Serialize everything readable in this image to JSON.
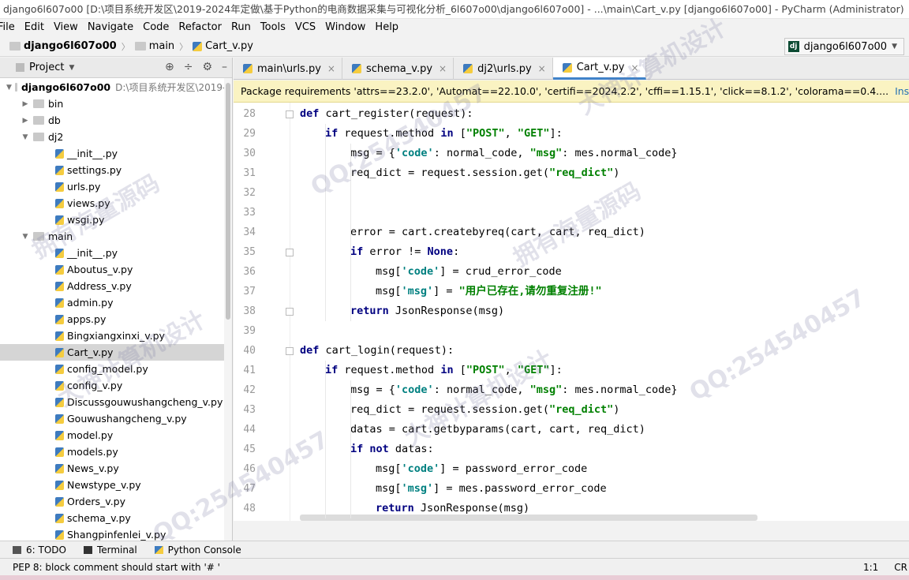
{
  "window": {
    "title": "django6l607o00 [D:\\项目系统开发区\\2019-2024年定做\\基于Python的电商数据采集与可视化分析_6l607o00\\django6l607o00] - ...\\main\\Cart_v.py [django6l607o00] - PyCharm (Administrator)"
  },
  "menu": [
    "File",
    "Edit",
    "View",
    "Navigate",
    "Code",
    "Refactor",
    "Run",
    "Tools",
    "VCS",
    "Window",
    "Help"
  ],
  "breadcrumb": {
    "project": "django6l607o00",
    "folder": "main",
    "file": "Cart_v.py"
  },
  "run_config": {
    "label": "django6l607o00",
    "icon": "dj"
  },
  "project_panel": {
    "title": "Project",
    "root": {
      "name": "django6l607o00",
      "path": "D:\\项目系统开发区\\2019-2"
    },
    "items": [
      {
        "label": "bin",
        "type": "folder",
        "level": 1,
        "state": "collapsed"
      },
      {
        "label": "db",
        "type": "folder",
        "level": 1,
        "state": "collapsed"
      },
      {
        "label": "dj2",
        "type": "folder",
        "level": 1,
        "state": "expanded"
      },
      {
        "label": "__init__.py",
        "type": "py",
        "level": 2
      },
      {
        "label": "settings.py",
        "type": "py",
        "level": 2
      },
      {
        "label": "urls.py",
        "type": "py",
        "level": 2
      },
      {
        "label": "views.py",
        "type": "py",
        "level": 2
      },
      {
        "label": "wsgi.py",
        "type": "py",
        "level": 2
      },
      {
        "label": "main",
        "type": "folder",
        "level": 1,
        "state": "expanded"
      },
      {
        "label": "__init__.py",
        "type": "py",
        "level": 2
      },
      {
        "label": "Aboutus_v.py",
        "type": "py",
        "level": 2
      },
      {
        "label": "Address_v.py",
        "type": "py",
        "level": 2
      },
      {
        "label": "admin.py",
        "type": "py",
        "level": 2
      },
      {
        "label": "apps.py",
        "type": "py",
        "level": 2
      },
      {
        "label": "Bingxiangxinxi_v.py",
        "type": "py",
        "level": 2
      },
      {
        "label": "Cart_v.py",
        "type": "py",
        "level": 2,
        "selected": true
      },
      {
        "label": "config_model.py",
        "type": "py",
        "level": 2
      },
      {
        "label": "config_v.py",
        "type": "py",
        "level": 2
      },
      {
        "label": "Discussgouwushangcheng_v.py",
        "type": "py",
        "level": 2
      },
      {
        "label": "Gouwushangcheng_v.py",
        "type": "py",
        "level": 2
      },
      {
        "label": "model.py",
        "type": "py",
        "level": 2
      },
      {
        "label": "models.py",
        "type": "py",
        "level": 2
      },
      {
        "label": "News_v.py",
        "type": "py",
        "level": 2
      },
      {
        "label": "Newstype_v.py",
        "type": "py",
        "level": 2
      },
      {
        "label": "Orders_v.py",
        "type": "py",
        "level": 2
      },
      {
        "label": "schema_v.py",
        "type": "py",
        "level": 2
      },
      {
        "label": "Shangpinfenlei_v.py",
        "type": "py",
        "level": 2
      }
    ]
  },
  "tabs": [
    {
      "label": "main\\urls.py",
      "active": false
    },
    {
      "label": "schema_v.py",
      "active": false
    },
    {
      "label": "dj2\\urls.py",
      "active": false
    },
    {
      "label": "Cart_v.py",
      "active": true
    }
  ],
  "banner": {
    "text": "Package requirements 'attrs==23.2.0', 'Automat==22.10.0', 'certifi==2024.2.2', 'cffi==1.15.1', 'click==8.1.2', 'colorama==0.4....",
    "action": "Install requirements"
  },
  "code_lines": [
    {
      "n": "28",
      "indent": 0,
      "tokens": [
        [
          "kw",
          "def"
        ],
        [
          "t",
          " cart_register(request):"
        ]
      ]
    },
    {
      "n": "29",
      "indent": 1,
      "tokens": [
        [
          "kw",
          "if"
        ],
        [
          "t",
          " request.method "
        ],
        [
          "kw",
          "in"
        ],
        [
          "t",
          " ["
        ],
        [
          "str",
          "\"POST\""
        ],
        [
          "t",
          ", "
        ],
        [
          "str",
          "\"GET\""
        ],
        [
          "t",
          "]:"
        ]
      ]
    },
    {
      "n": "30",
      "indent": 2,
      "tokens": [
        [
          "t",
          "msg = {"
        ],
        [
          "hs",
          "'code'"
        ],
        [
          "t",
          ": normal_code, "
        ],
        [
          "str",
          "\"msg\""
        ],
        [
          "t",
          ": mes.normal_code}"
        ]
      ]
    },
    {
      "n": "31",
      "indent": 2,
      "tokens": [
        [
          "t",
          "req_dict = request.session.get("
        ],
        [
          "str",
          "\"req_dict\""
        ],
        [
          "t",
          ")"
        ]
      ]
    },
    {
      "n": "32",
      "indent": 0,
      "tokens": []
    },
    {
      "n": "33",
      "indent": 0,
      "tokens": []
    },
    {
      "n": "34",
      "indent": 2,
      "tokens": [
        [
          "t",
          "error = cart.createbyreq(cart, cart, req_dict)"
        ]
      ]
    },
    {
      "n": "35",
      "indent": 2,
      "tokens": [
        [
          "kw",
          "if"
        ],
        [
          "t",
          " error != "
        ],
        [
          "kw",
          "None"
        ],
        [
          "t",
          ":"
        ]
      ]
    },
    {
      "n": "36",
      "indent": 3,
      "tokens": [
        [
          "t",
          "msg["
        ],
        [
          "hs",
          "'code'"
        ],
        [
          "t",
          "] = crud_error_code"
        ]
      ]
    },
    {
      "n": "37",
      "indent": 3,
      "tokens": [
        [
          "t",
          "msg["
        ],
        [
          "hs",
          "'msg'"
        ],
        [
          "t",
          "] = "
        ],
        [
          "str",
          "\"用户已存在,请勿重复注册!\""
        ]
      ]
    },
    {
      "n": "38",
      "indent": 2,
      "tokens": [
        [
          "kw",
          "return"
        ],
        [
          "t",
          " JsonResponse(msg)"
        ]
      ]
    },
    {
      "n": "39",
      "indent": 0,
      "tokens": []
    },
    {
      "n": "40",
      "indent": 0,
      "tokens": [
        [
          "kw",
          "def"
        ],
        [
          "t",
          " cart_login(request):"
        ]
      ]
    },
    {
      "n": "41",
      "indent": 1,
      "tokens": [
        [
          "kw",
          "if"
        ],
        [
          "t",
          " request.method "
        ],
        [
          "kw",
          "in"
        ],
        [
          "t",
          " ["
        ],
        [
          "str",
          "\"POST\""
        ],
        [
          "t",
          ", "
        ],
        [
          "str",
          "\"GET\""
        ],
        [
          "t",
          "]:"
        ]
      ]
    },
    {
      "n": "42",
      "indent": 2,
      "tokens": [
        [
          "t",
          "msg = {"
        ],
        [
          "hs",
          "'code'"
        ],
        [
          "t",
          ": normal_code, "
        ],
        [
          "str",
          "\"msg\""
        ],
        [
          "t",
          ": mes.normal_code}"
        ]
      ]
    },
    {
      "n": "43",
      "indent": 2,
      "tokens": [
        [
          "t",
          "req_dict = request.session.get("
        ],
        [
          "str",
          "\"req_dict\""
        ],
        [
          "t",
          ")"
        ]
      ]
    },
    {
      "n": "44",
      "indent": 2,
      "tokens": [
        [
          "t",
          "datas = cart.getbyparams(cart, cart, req_dict)"
        ]
      ]
    },
    {
      "n": "45",
      "indent": 2,
      "tokens": [
        [
          "kw",
          "if not"
        ],
        [
          "t",
          " datas:"
        ]
      ]
    },
    {
      "n": "46",
      "indent": 3,
      "tokens": [
        [
          "t",
          "msg["
        ],
        [
          "hs",
          "'code'"
        ],
        [
          "t",
          "] = password_error_code"
        ]
      ]
    },
    {
      "n": "47",
      "indent": 3,
      "tokens": [
        [
          "t",
          "msg["
        ],
        [
          "hs",
          "'msg'"
        ],
        [
          "t",
          "] = mes.password_error_code"
        ]
      ]
    },
    {
      "n": "48",
      "indent": 3,
      "tokens": [
        [
          "kw",
          "return"
        ],
        [
          "t",
          " JsonResponse(msg)"
        ]
      ]
    }
  ],
  "bottom_tools": [
    {
      "label": "6: TODO",
      "icon": "todo-icon"
    },
    {
      "label": "Terminal",
      "icon": "terminal-icon"
    },
    {
      "label": "Python Console",
      "icon": "python-console-icon"
    }
  ],
  "status": {
    "message": "PEP 8: block comment should start with '# '",
    "position": "1:1",
    "line_sep": "CR"
  },
  "watermarks": [
    "QQ:254540457",
    "大神计算机设计",
    "拥有海量源码"
  ]
}
